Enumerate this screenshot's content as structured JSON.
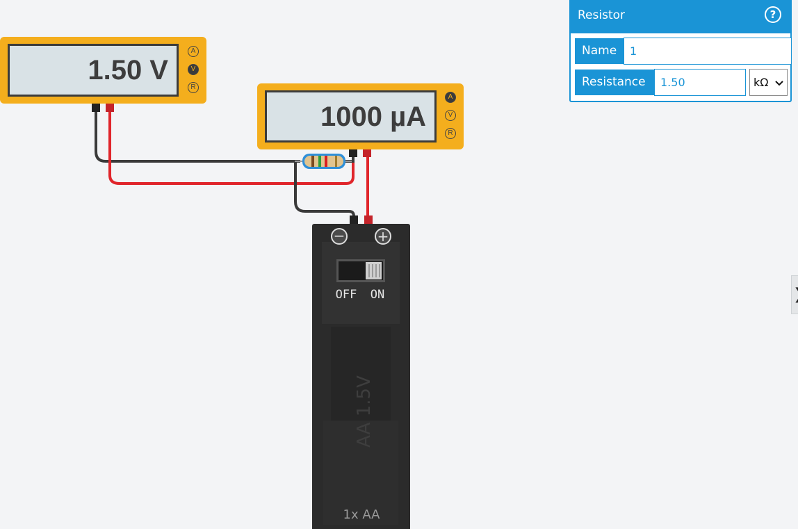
{
  "voltmeter": {
    "reading": "1.50 V",
    "modes": [
      "A",
      "V",
      "R"
    ],
    "active_mode": "V"
  },
  "ammeter": {
    "reading": "1000 µA",
    "modes": [
      "A",
      "V",
      "R"
    ],
    "active_mode": "A"
  },
  "battery": {
    "switch_off_label": "OFF",
    "switch_on_label": "ON",
    "cell_label": "AA 1.5V",
    "holder_label": "1x AA",
    "switch_state": "on",
    "minus_symbol": "−",
    "plus_symbol": "+"
  },
  "panel": {
    "title": "Resistor",
    "help_label": "?",
    "name_label": "Name",
    "name_value": "1",
    "resistance_label": "Resistance",
    "resistance_value": "1.50",
    "unit_value": "kΩ"
  },
  "side_tab": {
    "glyph": "❯"
  },
  "colors": {
    "meter_body": "#f4ae1d",
    "wire_red": "#e0252b",
    "wire_black": "#3a3a3a",
    "panel_accent": "#1a94d6",
    "battery_body": "#2b2b2b"
  }
}
